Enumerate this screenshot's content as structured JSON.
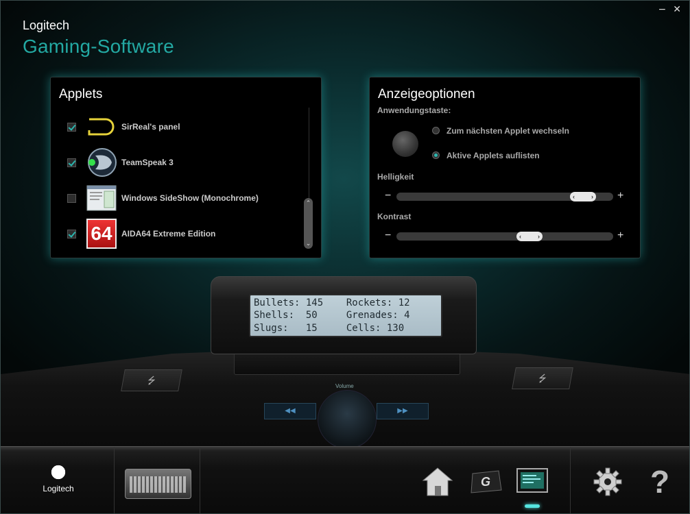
{
  "window": {
    "minimize_glyph": "−",
    "close_glyph": "✕"
  },
  "brand": {
    "company": "Logitech",
    "product": "Gaming-Software"
  },
  "applets": {
    "title": "Applets",
    "items": [
      {
        "label": "SirReal's panel",
        "checked": true,
        "icon": "sirreal-icon"
      },
      {
        "label": "TeamSpeak 3",
        "checked": true,
        "icon": "teamspeak-icon"
      },
      {
        "label": "Windows SideShow (Monochrome)",
        "checked": false,
        "icon": "sideshow-icon"
      },
      {
        "label": "AIDA64 Extreme Edition",
        "checked": true,
        "icon": "aida64-icon"
      }
    ],
    "aida_icon_text": "64",
    "scroll_up": "⌃",
    "scroll_down": "⌄"
  },
  "options": {
    "title": "Anzeigeoptionen",
    "app_key_label": "Anwendungstaste:",
    "radio_next": "Zum nächsten Applet wechseln",
    "radio_list": "Aktive Applets auflisten",
    "selected_radio": "list",
    "brightness_label": "Helligkeit",
    "brightness_value": 0.91,
    "contrast_label": "Kontrast",
    "contrast_value": 0.63,
    "minus": "−",
    "plus": "+",
    "thumb_left": "‹",
    "thumb_right": "›"
  },
  "lcd": {
    "line1": "Bullets: 145    Rockets: 12",
    "line2": "Shells:  50     Grenades: 4",
    "line3": "Slugs:   15     Cells: 130"
  },
  "device": {
    "volume_label": "Volume",
    "usb_glyph": "⭍",
    "prev_glyph": "◀◀",
    "next_glyph": "▶▶"
  },
  "footer": {
    "logo_label": "Logitech",
    "help_glyph": "?"
  },
  "colors": {
    "accent": "#23a9a3",
    "active_indicator": "#55e5e0"
  }
}
